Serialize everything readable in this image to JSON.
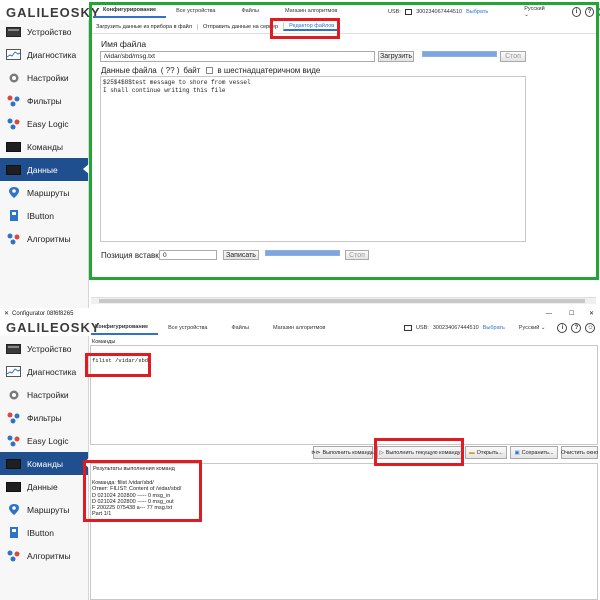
{
  "top": {
    "logo": "GALILEOSKY",
    "tabs": [
      "Конфигурирование",
      "Все устройства",
      "Файлы",
      "Магазин алгоритмов"
    ],
    "usb_label": "USB:",
    "usb_id": "300234067444510",
    "select_link": "Выбрать",
    "language": "Русский",
    "subtabs": [
      "Загрузить данные из прибора в файл",
      "Отправить данные на сервер",
      "Редактор файлов"
    ],
    "filename_label": "Имя файла",
    "filename_value": "/vidar/sbd/msg.txt",
    "upload_btn": "Загрузить",
    "stop_btn": "Стоп",
    "filedata_label": "Данные файла",
    "filedata_size": "(   ??   )",
    "bytes_label": "байт",
    "hex_label": "в шестнадцатеричном виде",
    "file_lines": [
      "$25$4$8$test message to shore from vessel",
      "I shall continue writing this file"
    ],
    "insert_pos_label": "Позиция вставки",
    "insert_pos_value": "0",
    "write_btn": "Записать",
    "stop2_btn": "Стоп"
  },
  "bottom": {
    "window_title": "Configurator 08f6f8265",
    "logo": "GALILEOSKY",
    "tabs": [
      "Конфигурирование",
      "Все устройства",
      "Файлы",
      "Магазин алгоритмов"
    ],
    "usb_label": "USB:",
    "usb_id": "300234067444510",
    "select_link": "Выбрать",
    "language": "Русский",
    "commands_label": "Команды",
    "command_text": "filist /vidar/sbd/",
    "buttons": [
      "Выполнить команды",
      "Выполнить текущую команду",
      "Открыть...",
      "Сохранить...",
      "Очистить окно"
    ],
    "results_label": "Результаты выполнения команд",
    "result_lines": [
      "Команда: filist /vidar/sbd/",
      "Ответ: FILIST: Content of /vidar/sbd/",
      "D 021024 202800 ----- 0 msg_in",
      "D 021024 202800 ----- 0 msg_out",
      "F 200225 075438 a--- 77 msg.txt",
      "Part 1/1"
    ]
  },
  "sidebar_items": [
    {
      "label": "Устройство",
      "icon": "device-icon"
    },
    {
      "label": "Диагностика",
      "icon": "diagnostics-icon"
    },
    {
      "label": "Настройки",
      "icon": "gear-icon"
    },
    {
      "label": "Фильтры",
      "icon": "filters-icon"
    },
    {
      "label": "Easy Logic",
      "icon": "easy-logic-icon"
    },
    {
      "label": "Команды",
      "icon": "commands-icon"
    },
    {
      "label": "Данные",
      "icon": "data-icon"
    },
    {
      "label": "Маршруты",
      "icon": "routes-icon"
    },
    {
      "label": "IButton",
      "icon": "ibutton-icon"
    },
    {
      "label": "Алгоритмы",
      "icon": "algorithms-icon"
    }
  ],
  "colors": {
    "accent": "#1f4f8f",
    "highlight_red": "#e11b22",
    "highlight_green": "#21a535",
    "progress": "#7ea6de"
  }
}
